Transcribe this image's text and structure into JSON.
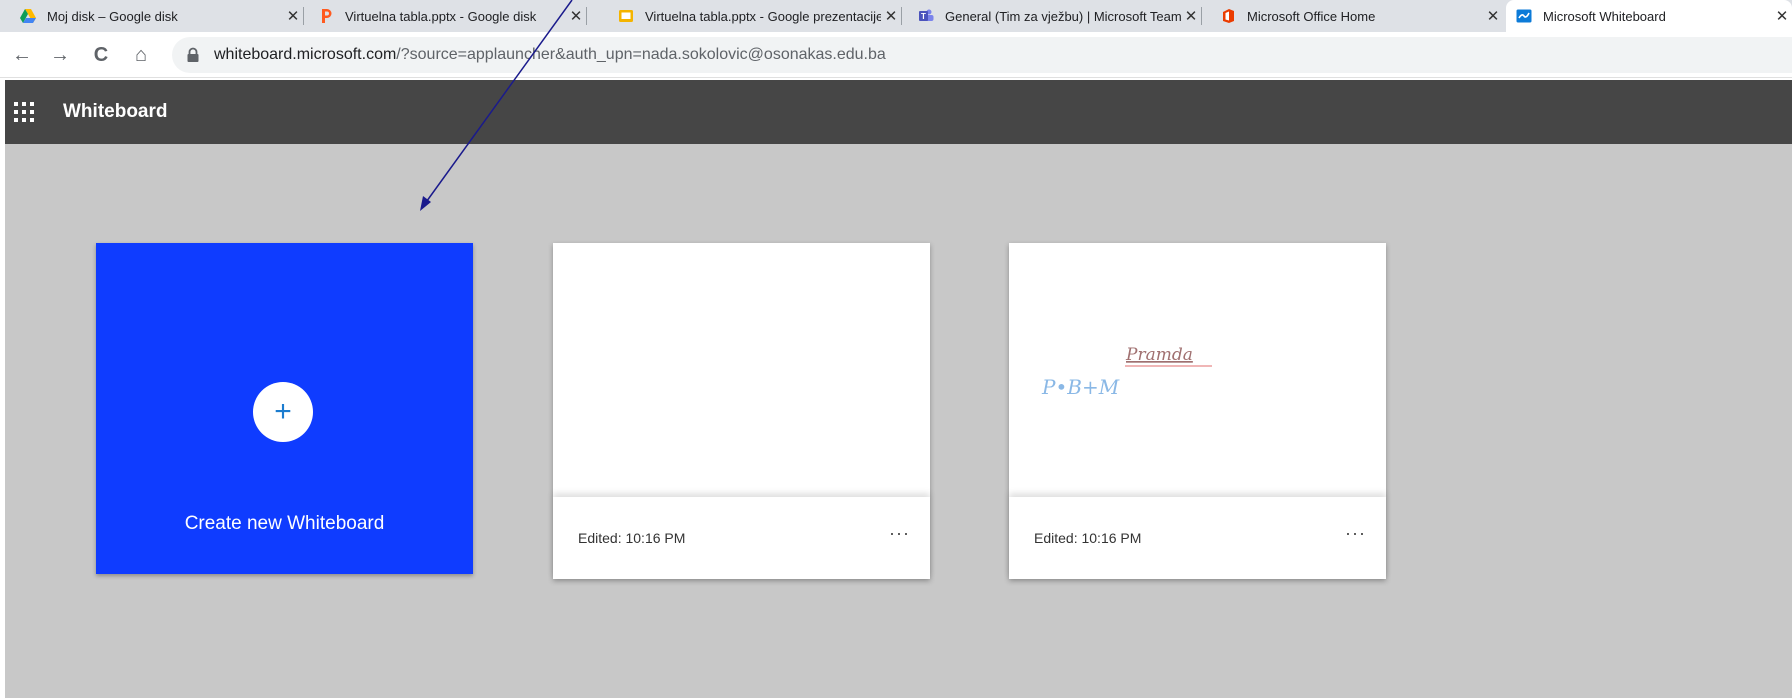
{
  "browser": {
    "tabs": [
      {
        "title": "Moj disk – Google disk",
        "icon": "google-drive-icon",
        "close": "✕"
      },
      {
        "title": "Virtuelna tabla.pptx - Google disk",
        "icon": "powerpoint-p-icon",
        "close": "✕"
      },
      {
        "title": "Virtuelna tabla.pptx - Google prezentacije",
        "icon": "google-slides-icon",
        "close": "✕"
      },
      {
        "title": "General (Tim za vježbu) | Microsoft Teams",
        "icon": "teams-icon",
        "close": "✕"
      },
      {
        "title": "Microsoft Office Home",
        "icon": "office-icon",
        "close": "✕"
      },
      {
        "title": "Microsoft Whiteboard",
        "icon": "whiteboard-icon",
        "close": "✕",
        "active": true
      }
    ],
    "nav": {
      "back": "←",
      "forward": "→",
      "reload": "C",
      "home": "⌂"
    },
    "url": {
      "host": "whiteboard.microsoft.com",
      "rest": "/?source=applauncher&auth_upn=nada.sokolovic@osonakas.edu.ba"
    }
  },
  "app": {
    "title": "Whiteboard",
    "create": {
      "label": "Create new Whiteboard",
      "plus": "+"
    },
    "boards": [
      {
        "edited": "Edited: 10:16 PM",
        "more": "···",
        "sketch": []
      },
      {
        "edited": "Edited: 10:16 PM",
        "more": "···",
        "sketch": [
          {
            "text": "P•B+M",
            "color": "#8ab8e6"
          },
          {
            "text": "Pramda",
            "color": "#a07070"
          }
        ]
      }
    ]
  },
  "colors": {
    "tabstrip": "#dee1e6",
    "appbar": "#464646",
    "canvas": "#c8c8c8",
    "create_tile": "#0f3cff",
    "arrow": "#1a1a8c"
  }
}
